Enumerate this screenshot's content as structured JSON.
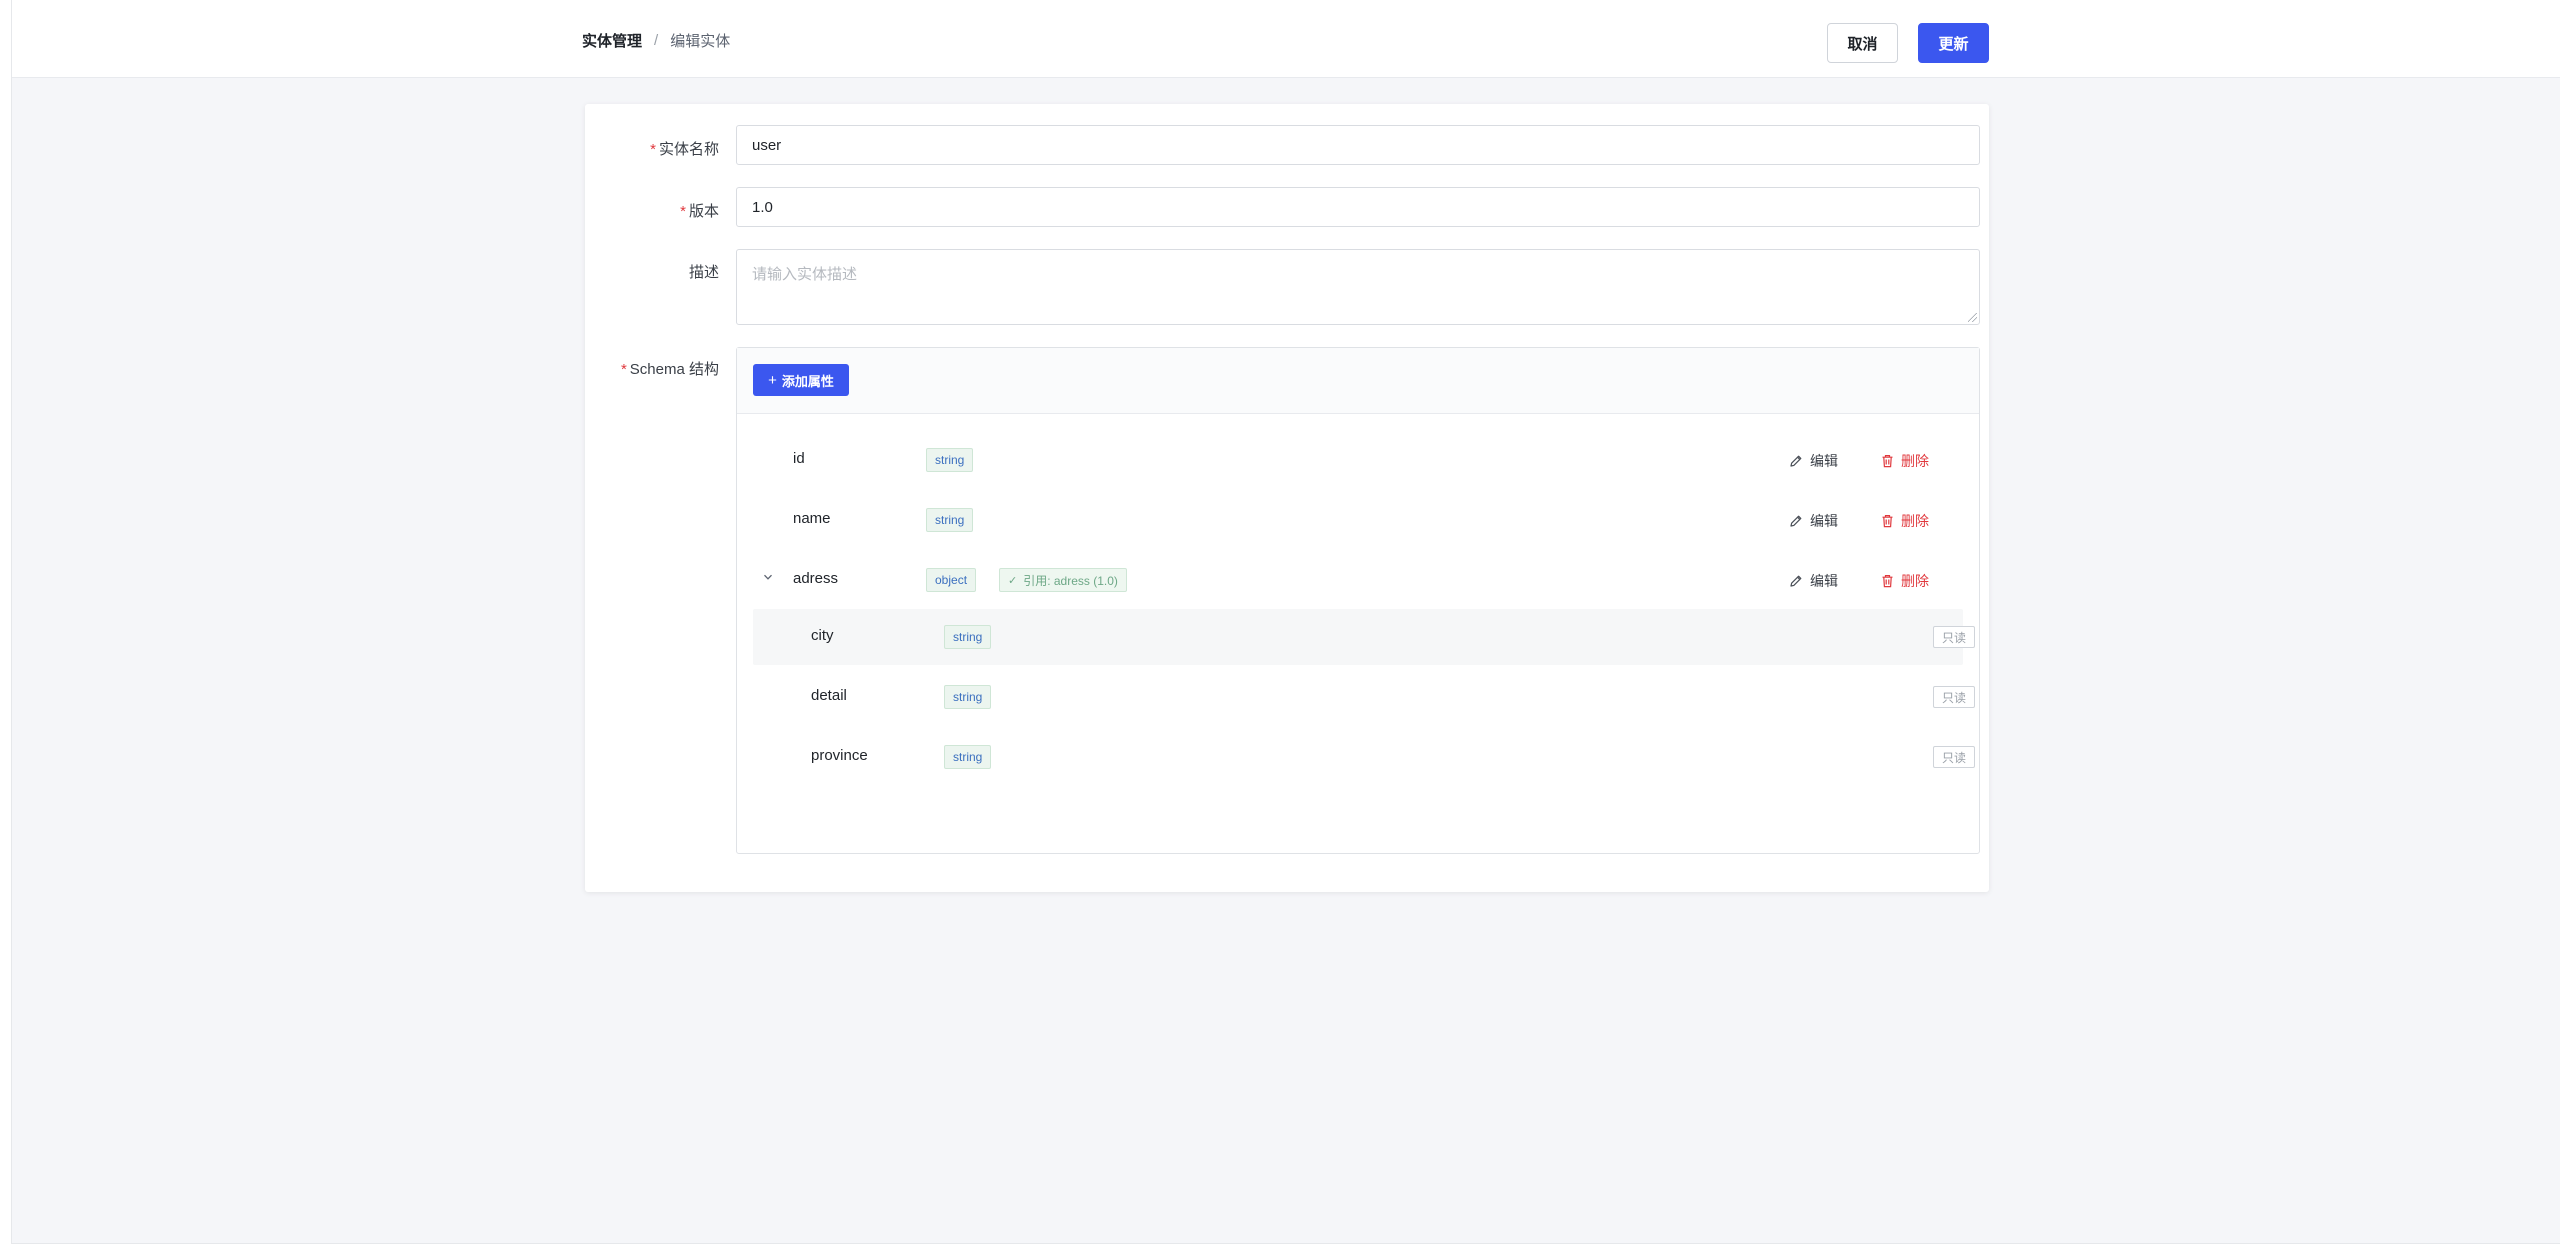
{
  "header": {
    "breadcrumb_root": "实体管理",
    "breadcrumb_sep": "/",
    "breadcrumb_current": "编辑实体",
    "cancel_label": "取消",
    "update_label": "更新"
  },
  "form": {
    "name_label": "实体名称",
    "name_value": "user",
    "version_label": "版本",
    "version_value": "1.0",
    "desc_label": "描述",
    "desc_placeholder": "请输入实体描述",
    "schema_label": "Schema 结构",
    "required_mark": "*"
  },
  "schema": {
    "add_label": "添加属性",
    "add_icon": "+",
    "edit_label": "编辑",
    "delete_label": "删除",
    "readonly_label": "只读",
    "properties": [
      {
        "name": "id",
        "type": "string"
      },
      {
        "name": "name",
        "type": "string"
      },
      {
        "name": "adress",
        "type": "object",
        "ref": "引用: adress (1.0)",
        "expanded": true,
        "children": [
          {
            "name": "city",
            "type": "string"
          },
          {
            "name": "detail",
            "type": "string"
          },
          {
            "name": "province",
            "type": "string"
          }
        ]
      }
    ]
  },
  "colors": {
    "primary": "#3b57ef",
    "danger": "#e0393e",
    "required": "#e0393e",
    "tag_bg": "#ecf5ef"
  }
}
